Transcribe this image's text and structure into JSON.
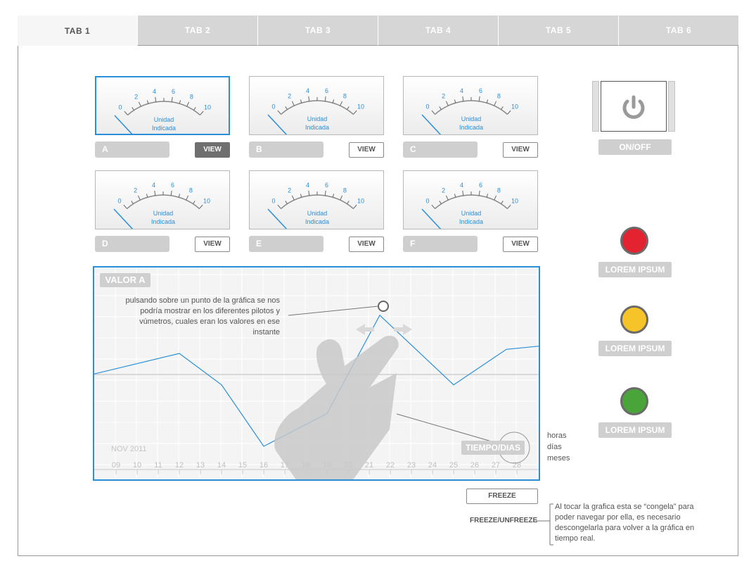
{
  "tabs": [
    "TAB 1",
    "TAB 2",
    "TAB 3",
    "TAB 4",
    "TAB 5",
    "TAB 6"
  ],
  "gauges": [
    {
      "label": "A",
      "view": "VIEW"
    },
    {
      "label": "B",
      "view": "VIEW"
    },
    {
      "label": "C",
      "view": "VIEW"
    },
    {
      "label": "D",
      "view": "VIEW"
    },
    {
      "label": "E",
      "view": "VIEW"
    },
    {
      "label": "F",
      "view": "VIEW"
    }
  ],
  "gauge_scale": {
    "ticks": [
      "0",
      "2",
      "4",
      "6",
      "8",
      "10"
    ],
    "unit_line1": "Unidad",
    "unit_line2": "Indicada",
    "value": 0
  },
  "power": {
    "label": "ON/OFF",
    "icon": "power-icon"
  },
  "lights": [
    {
      "label": "LOREM IPSUM",
      "color": "#e3232f"
    },
    {
      "label": "LOREM IPSUM",
      "color": "#f6c429"
    },
    {
      "label": "LOREM IPSUM",
      "color": "#49a539"
    }
  ],
  "chart": {
    "title": "VALOR A",
    "period": "NOV 2011",
    "time_button": "TIEMPO/DIAS",
    "time_options": [
      "horas",
      "días",
      "meses"
    ],
    "annotation": "pulsando sobre un punto de la gráfica se nos podría mostrar en los diferentes pilotos y vúmetros, cuales eran los valores en ese instante",
    "accent": "#2a8fd8"
  },
  "chart_data": {
    "type": "line",
    "x": [
      "09",
      "10",
      "11",
      "12",
      "13",
      "14",
      "15",
      "16",
      "17",
      "18",
      "19",
      "20",
      "21",
      "22",
      "23",
      "24",
      "25",
      "26",
      "27",
      "28"
    ],
    "series": [
      {
        "values": [
          null,
          null,
          null,
          null,
          null,
          null,
          null,
          null,
          null,
          null,
          null,
          null,
          null,
          null,
          null,
          null,
          null,
          null,
          null,
          null
        ]
      }
    ],
    "points": [
      [
        "09",
        53
      ],
      [
        "12",
        68
      ],
      [
        "14",
        45
      ],
      [
        "16",
        0
      ],
      [
        "19",
        24
      ],
      [
        "21.5",
        96
      ],
      [
        "25",
        45
      ],
      [
        "27.5",
        71
      ],
      [
        "29.5",
        74
      ]
    ],
    "ylim": [
      0,
      100
    ],
    "xlabel": "",
    "ylabel": "",
    "grid": true
  },
  "freeze": {
    "button": "FREEZE",
    "label": "FREEZE/UNFREEZE",
    "note": "Al tocar la grafica esta se “congela” para poder navegar por ella, es necesario descongelarla para volver a la gráfica en tiempo real."
  }
}
